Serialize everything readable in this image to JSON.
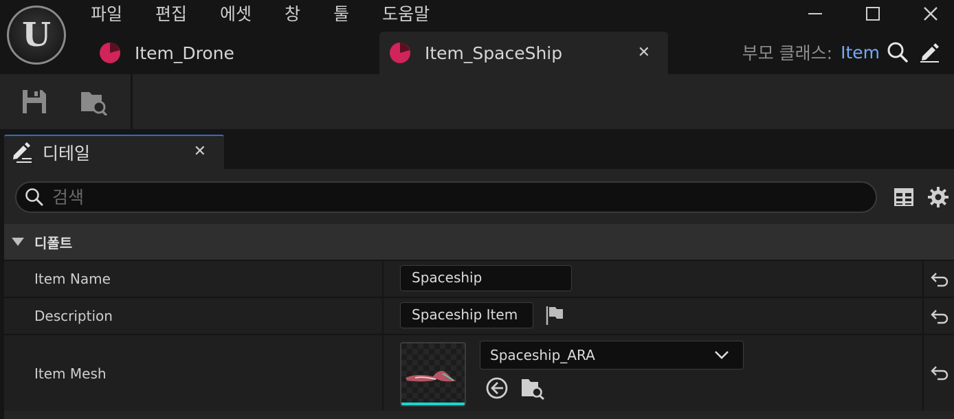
{
  "menu": [
    "파일",
    "편집",
    "에셋",
    "창",
    "툴",
    "도움말"
  ],
  "tabs": [
    {
      "label": "Item_Drone",
      "active": false
    },
    {
      "label": "Item_SpaceShip",
      "active": true
    }
  ],
  "parent_class": {
    "label": "부모 클래스:",
    "value": "Item"
  },
  "details": {
    "tab_label": "디테일",
    "search_placeholder": "검색",
    "category": "디폴트",
    "properties": {
      "item_name": {
        "label": "Item Name",
        "value": "Spaceship"
      },
      "description": {
        "label": "Description",
        "value": "Spaceship Item"
      },
      "item_mesh": {
        "label": "Item Mesh",
        "value": "Spaceship_ARA"
      }
    }
  },
  "colors": {
    "accent_blue": "#75a9f5",
    "tab_icon": "#d0245a",
    "thumb_bar": "#19d6d0"
  }
}
